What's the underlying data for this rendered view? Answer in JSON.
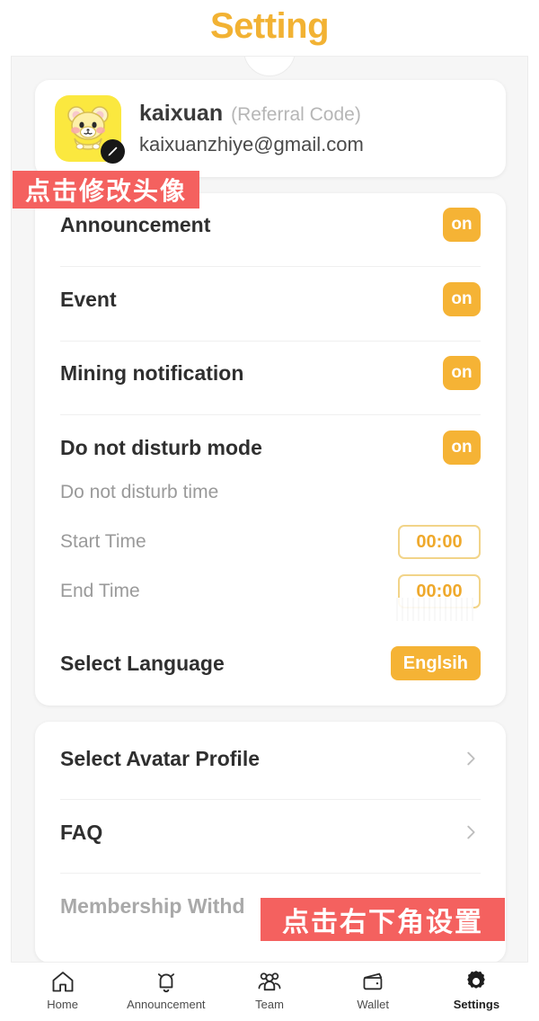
{
  "header": {
    "title": "Setting"
  },
  "profile": {
    "name": "kaixuan",
    "referral_label": "(Referral Code)",
    "email": "kaixuanzhiye@gmail.com",
    "avatar_icon": "hamster-avatar",
    "edit_icon": "pencil-icon"
  },
  "settings": {
    "rows": [
      {
        "label": "Announcement",
        "control": "on"
      },
      {
        "label": "Event",
        "control": "on"
      },
      {
        "label": "Mining notification",
        "control": "on"
      },
      {
        "label": "Do not disturb mode",
        "control": "on"
      }
    ],
    "dnd_time_label": "Do not disturb time",
    "start_time_label": "Start Time",
    "start_time_value": "00:00",
    "end_time_label": "End Time",
    "end_time_value": "00:00",
    "language_label": "Select Language",
    "language_value": "Englsih"
  },
  "links": [
    {
      "label": "Select Avatar Profile",
      "chevron": "chevron-right-icon"
    },
    {
      "label": "FAQ",
      "chevron": "chevron-right-icon"
    },
    {
      "label": "Membership Withd",
      "chevron": "chevron-right-icon"
    }
  ],
  "annotations": {
    "avatar_hint": "点击修改头像",
    "settings_hint": "点击右下角设置"
  },
  "bottom_nav": {
    "items": [
      {
        "label": "Home",
        "icon": "home-icon",
        "active": false
      },
      {
        "label": "Announcement",
        "icon": "bell-icon",
        "active": false
      },
      {
        "label": "Team",
        "icon": "people-group-icon",
        "active": false
      },
      {
        "label": "Wallet",
        "icon": "wallet-icon",
        "active": false
      },
      {
        "label": "Settings",
        "icon": "gear-icon",
        "active": true
      }
    ]
  },
  "colors": {
    "accent": "#f2b233",
    "toggle_on": "#f5b335",
    "time_border": "#f2d489",
    "time_text": "#efa92c",
    "annotation": "#f4615f",
    "avatar_bg": "#fbe83f"
  }
}
